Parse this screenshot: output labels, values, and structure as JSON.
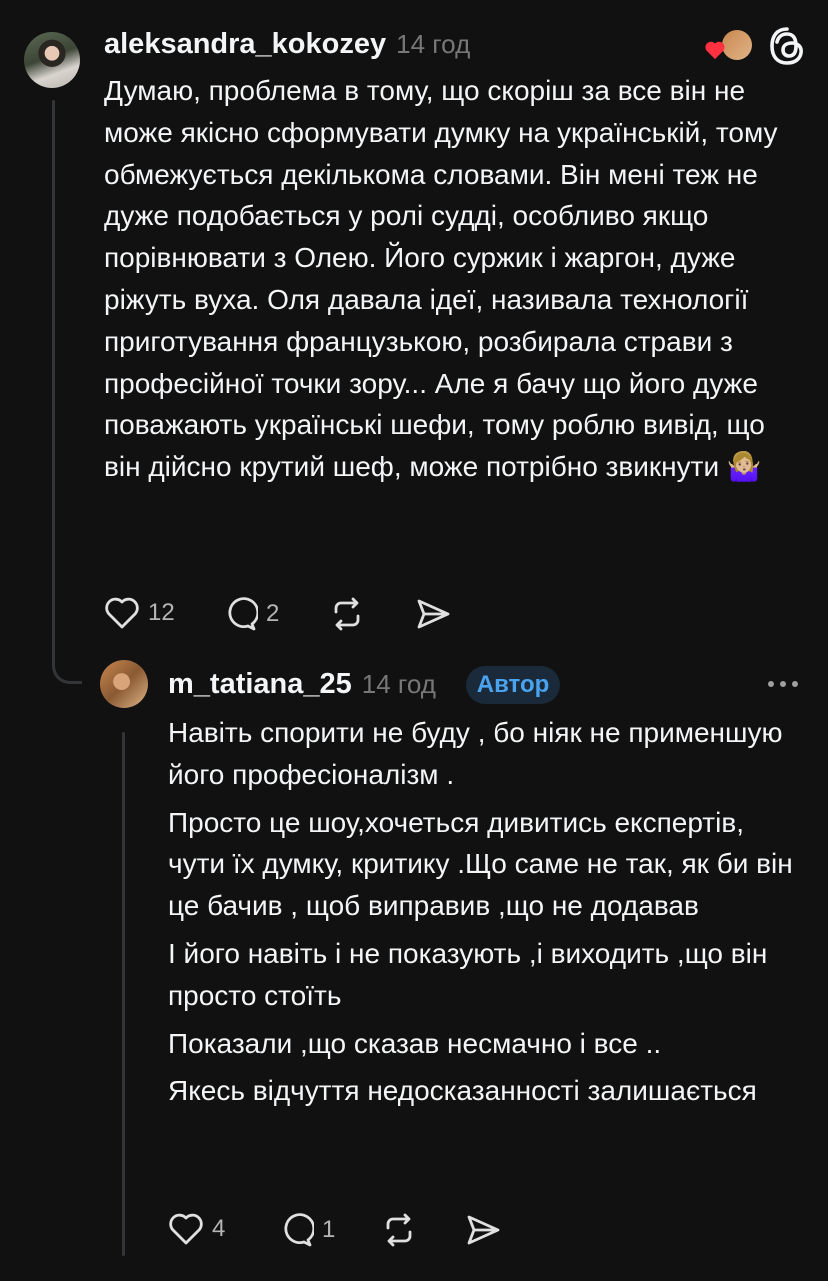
{
  "comment": {
    "username": "aleksandra_kokozey",
    "time": "14 год",
    "text": "Думаю, проблема в тому, що скоріш за все він не може якісно сформувати думку на українській, тому обмежується декількома словами. Він мені теж не дуже подобається у ролі судді, особливо якщо порівнювати з Олею. Його суржик і жаргон, дуже ріжуть вуха. Оля давала ідеї, називала технології приготування французькою, розбирала страви з професійної точки зору... Але я бачу що його дуже поважають українські шефи, тому роблю вивід, що він дійсно крутий шеф, може потрібно звикнути 🤷🏼‍♀️",
    "likes": "12",
    "replies": "2"
  },
  "reply": {
    "username": "m_tatiana_25",
    "time": "14 год",
    "badge": "Автор",
    "paragraphs": [
      "Навіть спорити не буду , бо ніяк не применшую його професіоналізм .",
      "Просто це шоу,хочеться дивитись експертів, чути їх думку, критику .Що саме не так, як би він це бачив , щоб виправив ,що не додавав",
      "І його навіть і не показують ,і виходить ,що він просто стоїть",
      "Показали ,що сказав несмачно і все ..",
      "Якесь відчуття недосказанності залишається"
    ],
    "likes": "4",
    "replies": "1"
  },
  "colors": {
    "background": "#111111",
    "text": "#f3f5f7",
    "muted": "#777777",
    "badge_text": "#4aa3ef",
    "heart": "#ff3040"
  }
}
